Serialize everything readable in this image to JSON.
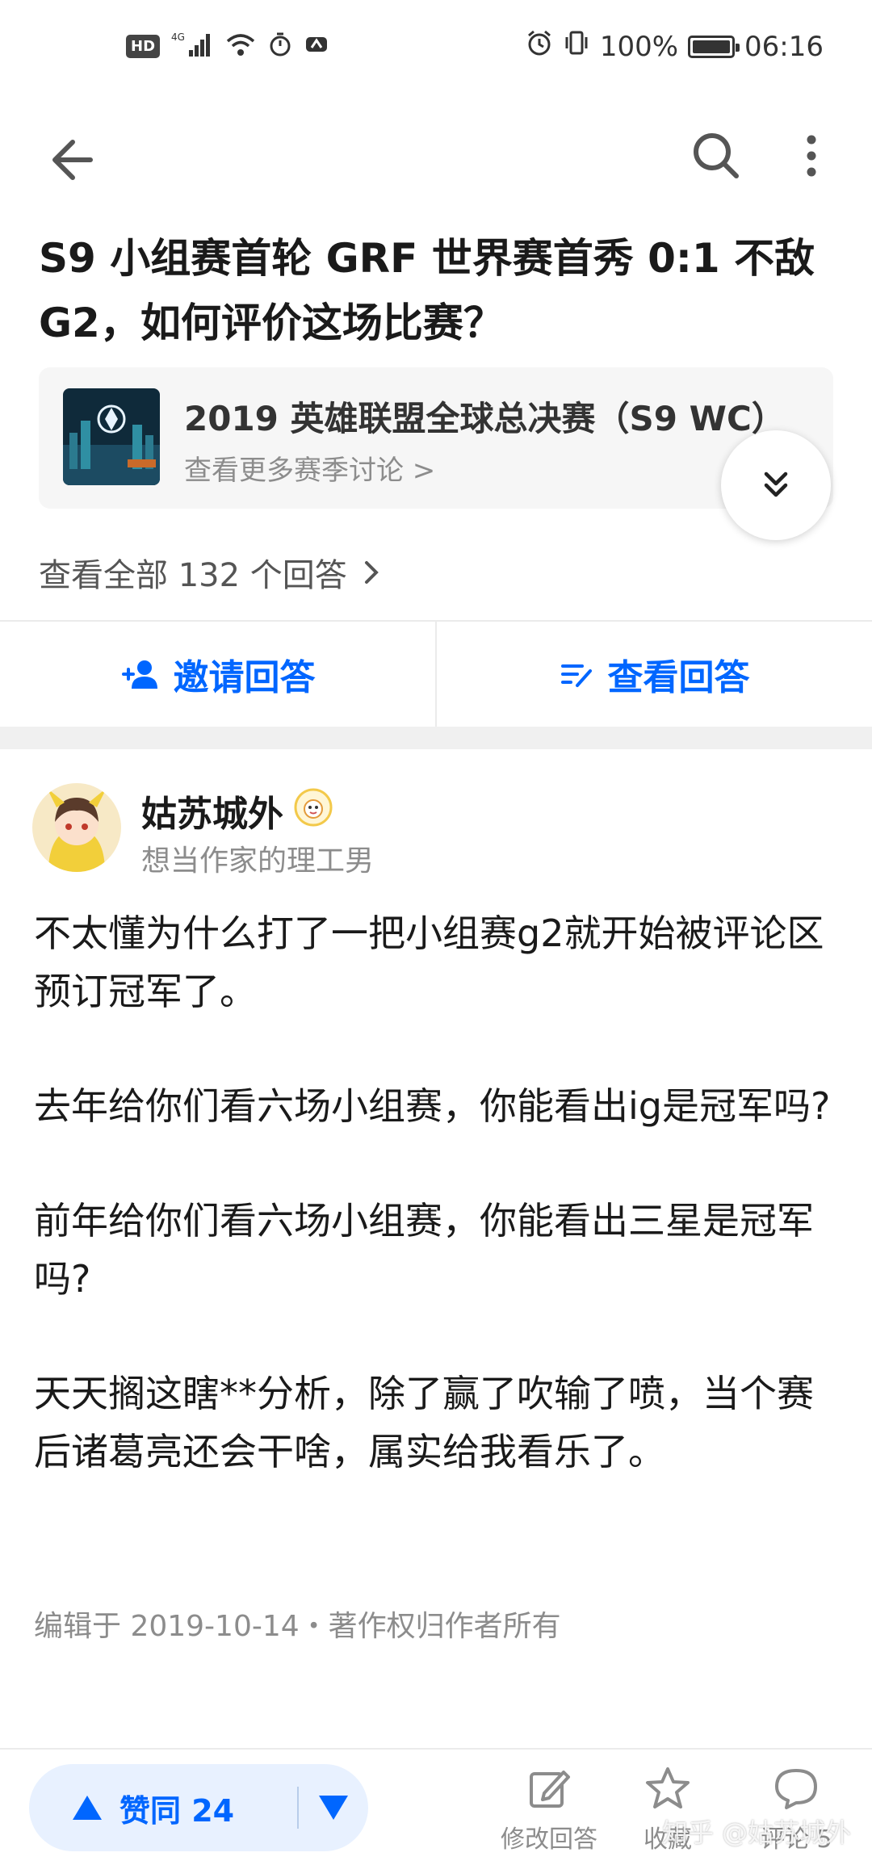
{
  "status_bar": {
    "hd": "HD",
    "network": "4G",
    "battery_pct_label": "100%",
    "battery_level": 1.0,
    "time": "06:16"
  },
  "question": {
    "title": "S9 小组赛首轮 GRF 世界赛首秀 0:1 不敌 G2，如何评价这场比赛？"
  },
  "topic": {
    "name": "2019 英雄联盟全球总决赛（S9 WC）",
    "more_link": "查看更多赛季讨论 >"
  },
  "view_all": {
    "label": "查看全部 132 个回答"
  },
  "actions": {
    "invite": "邀请回答",
    "view": "查看回答"
  },
  "author": {
    "name": "姑苏城外",
    "bio": "想当作家的理工男"
  },
  "answer": {
    "paragraphs": [
      "不太懂为什么打了一把小组赛g2就开始被评论区预订冠军了。",
      "去年给你们看六场小组赛，你能看出ig是冠军吗?",
      "前年给你们看六场小组赛，你能看出三星是冠军吗?",
      "天天搁这瞎**分析，除了赢了吹输了喷，当个赛后诸葛亮还会干啥，属实给我看乐了。"
    ],
    "meta": "编辑于 2019-10-14・著作权归作者所有"
  },
  "bottom_bar": {
    "vote_up_label": "赞同 24",
    "edit_label": "修改回答",
    "collect_label": "收藏",
    "comment_label": "评论 5"
  },
  "watermark": "知乎 @姑苏城外",
  "colors": {
    "accent": "#0066ff",
    "vote_bg": "#e8f1ff",
    "muted": "#8c8c8c"
  }
}
